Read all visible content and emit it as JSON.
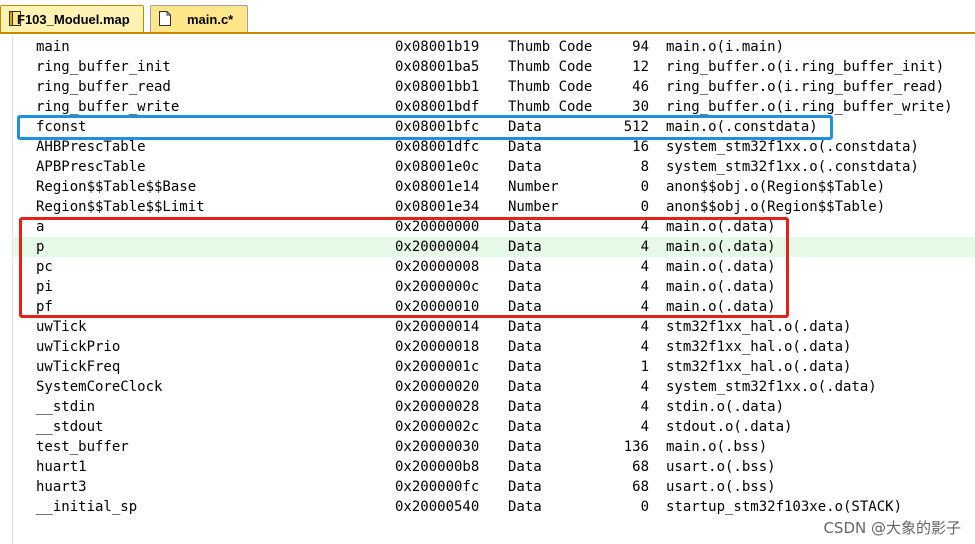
{
  "tabs": [
    {
      "label": "F103_Moduel.map",
      "active": true,
      "icon": "file-yellow-icon"
    },
    {
      "label": "main.c*",
      "active": false,
      "icon": "file-doc-icon"
    }
  ],
  "rows": [
    [
      "main",
      "0x08001b19",
      "Thumb Code",
      "94",
      "main.o(i.main)"
    ],
    [
      "ring_buffer_init",
      "0x08001ba5",
      "Thumb Code",
      "12",
      "ring_buffer.o(i.ring_buffer_init)"
    ],
    [
      "ring_buffer_read",
      "0x08001bb1",
      "Thumb Code",
      "46",
      "ring_buffer.o(i.ring_buffer_read)"
    ],
    [
      "ring_buffer_write",
      "0x08001bdf",
      "Thumb Code",
      "30",
      "ring_buffer.o(i.ring_buffer_write)"
    ],
    [
      "fconst",
      "0x08001bfc",
      "Data",
      "512",
      "main.o(.constdata)"
    ],
    [
      "AHBPrescTable",
      "0x08001dfc",
      "Data",
      "16",
      "system_stm32f1xx.o(.constdata)"
    ],
    [
      "APBPrescTable",
      "0x08001e0c",
      "Data",
      "8",
      "system_stm32f1xx.o(.constdata)"
    ],
    [
      "Region$$Table$$Base",
      "0x08001e14",
      "Number",
      "0",
      "anon$$obj.o(Region$$Table)"
    ],
    [
      "Region$$Table$$Limit",
      "0x08001e34",
      "Number",
      "0",
      "anon$$obj.o(Region$$Table)"
    ],
    [
      "a",
      "0x20000000",
      "Data",
      "4",
      "main.o(.data)"
    ],
    [
      "p",
      "0x20000004",
      "Data",
      "4",
      "main.o(.data)"
    ],
    [
      "pc",
      "0x20000008",
      "Data",
      "4",
      "main.o(.data)"
    ],
    [
      "pi",
      "0x2000000c",
      "Data",
      "4",
      "main.o(.data)"
    ],
    [
      "pf",
      "0x20000010",
      "Data",
      "4",
      "main.o(.data)"
    ],
    [
      "uwTick",
      "0x20000014",
      "Data",
      "4",
      "stm32f1xx_hal.o(.data)"
    ],
    [
      "uwTickPrio",
      "0x20000018",
      "Data",
      "4",
      "stm32f1xx_hal.o(.data)"
    ],
    [
      "uwTickFreq",
      "0x2000001c",
      "Data",
      "1",
      "stm32f1xx_hal.o(.data)"
    ],
    [
      "SystemCoreClock",
      "0x20000020",
      "Data",
      "4",
      "system_stm32f1xx.o(.data)"
    ],
    [
      "__stdin",
      "0x20000028",
      "Data",
      "4",
      "stdin.o(.data)"
    ],
    [
      "__stdout",
      "0x2000002c",
      "Data",
      "4",
      "stdout.o(.data)"
    ],
    [
      "test_buffer",
      "0x20000030",
      "Data",
      "136",
      "main.o(.bss)"
    ],
    [
      "huart1",
      "0x200000b8",
      "Data",
      "68",
      "usart.o(.bss)"
    ],
    [
      "huart3",
      "0x200000fc",
      "Data",
      "68",
      "usart.o(.bss)"
    ],
    [
      "__initial_sp",
      "0x20000540",
      "Data",
      "0",
      "startup_stm32f103xe.o(STACK)"
    ]
  ],
  "highlighted_row": 10,
  "annotations": {
    "blue_box_color": "#1e90e0",
    "red_box_color": "#e2231a"
  },
  "watermark": "CSDN @大象的影子"
}
